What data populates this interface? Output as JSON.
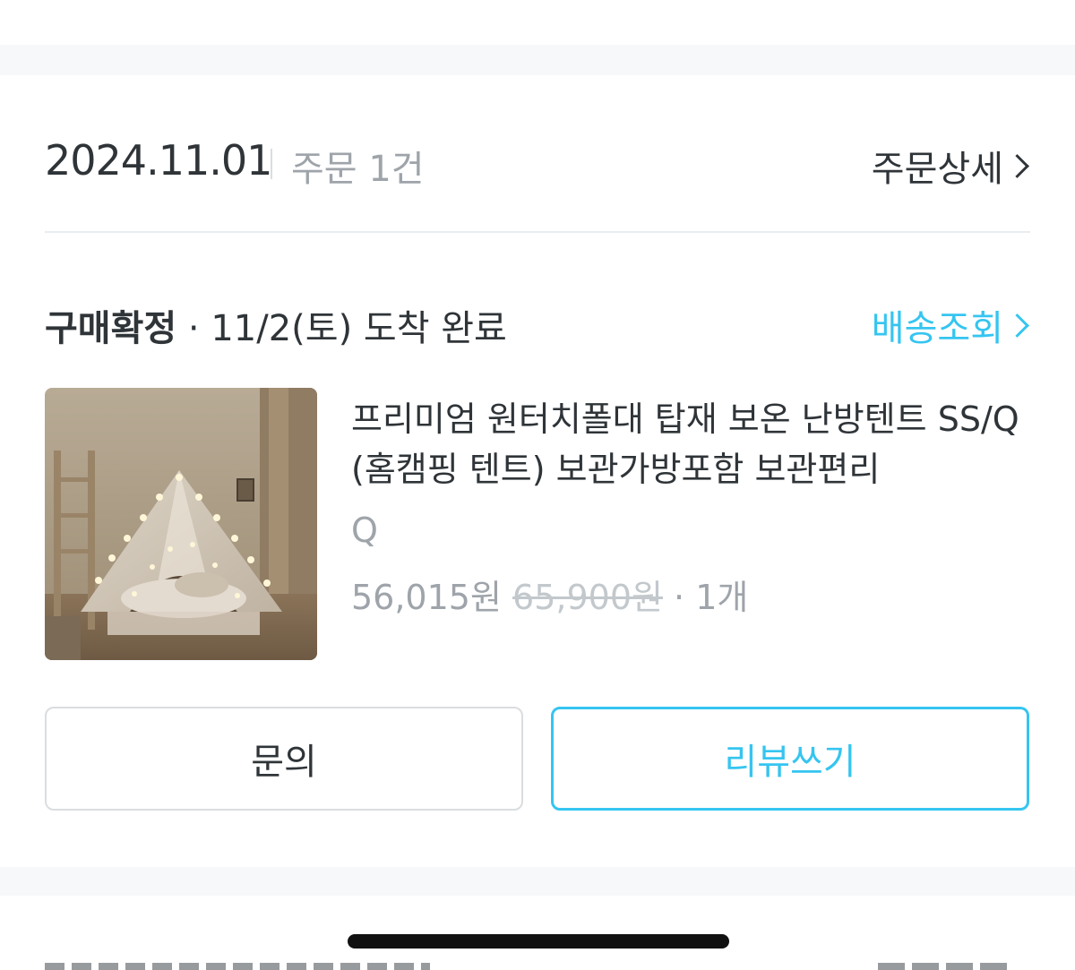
{
  "order": {
    "date": "2024.11.01",
    "count_label": "주문 1건",
    "detail_link": "주문상세"
  },
  "delivery": {
    "status": "구매확정",
    "status_detail": " · 11/2(토) 도착 완료",
    "tracking_link": "배송조회"
  },
  "product": {
    "name": "프리미엄 원터치폴대 탑재 보온 난방텐트 SS/Q (홈캠핑 텐트) 보관가방포함 보관편리",
    "option": "Q",
    "price": "56,015원",
    "original_price": "65,900원",
    "quantity": " · 1개"
  },
  "actions": {
    "inquiry": "문의",
    "review": "리뷰쓰기"
  },
  "colors": {
    "accent": "#35c5f0",
    "text_primary": "#2f3438",
    "text_secondary": "#9ea4aa"
  }
}
